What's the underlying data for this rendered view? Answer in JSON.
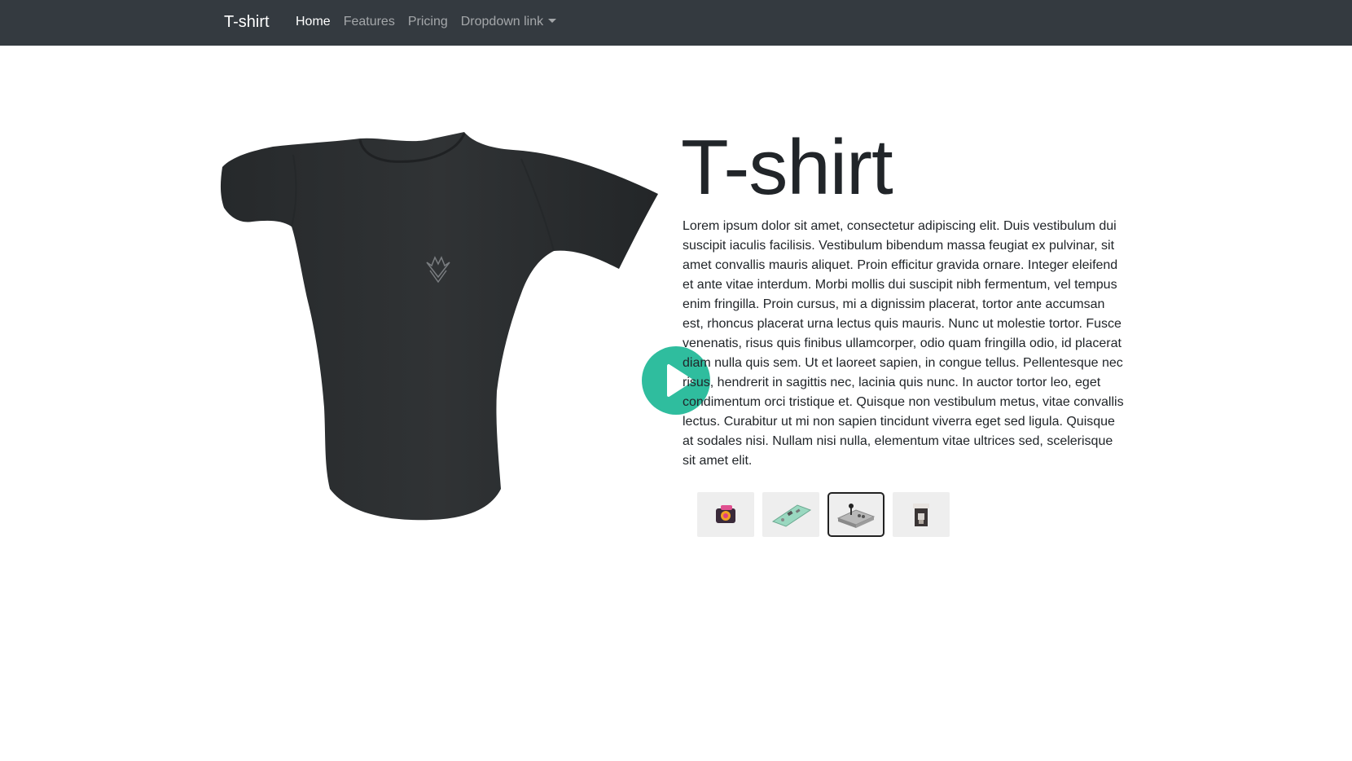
{
  "navbar": {
    "brand": "T-shirt",
    "links": [
      {
        "label": "Home",
        "active": true
      },
      {
        "label": "Features",
        "active": false
      },
      {
        "label": "Pricing",
        "active": false
      },
      {
        "label": "Dropdown link",
        "active": false,
        "dropdown": true
      }
    ]
  },
  "product": {
    "title": "T-shirt",
    "description": "Lorem ipsum dolor sit amet, consectetur adipiscing elit. Duis vestibulum dui suscipit iaculis facilisis. Vestibulum bibendum massa feugiat ex pulvinar, sit amet convallis mauris aliquet. Proin efficitur gravida ornare. Integer eleifend et ante vitae interdum. Morbi mollis dui suscipit nibh fermentum, vel tempus enim fringilla. Proin cursus, mi a dignissim placerat, tortor ante accumsan est, rhoncus placerat urna lectus quis mauris. Nunc ut molestie tortor. Fusce venenatis, risus quis finibus ullamcorper, odio quam fringilla odio, id placerat diam nulla quis sem. Ut et laoreet sapien, in congue tellus. Pellentesque nec risus, hendrerit in sagittis nec, lacinia quis nunc. In auctor tortor leo, eget condimentum orci tristique et. Quisque non vestibulum metus, vitae convallis lectus. Curabitur ut mi non sapien tincidunt viverra eget sed ligula. Quisque at sodales nisi. Nullam nisi nulla, elementum vitae ultrices sed, scelerisque sit amet elit."
  },
  "thumbnails": [
    {
      "icon": "camera-icon",
      "selected": false
    },
    {
      "icon": "circuit-board-icon",
      "selected": false
    },
    {
      "icon": "arcade-joystick-icon",
      "selected": true
    },
    {
      "icon": "coffee-machine-icon",
      "selected": false
    }
  ],
  "colors": {
    "navbar_bg": "#343a40",
    "play_button": "#2fbd9e",
    "shirt": "#2b2e30"
  }
}
